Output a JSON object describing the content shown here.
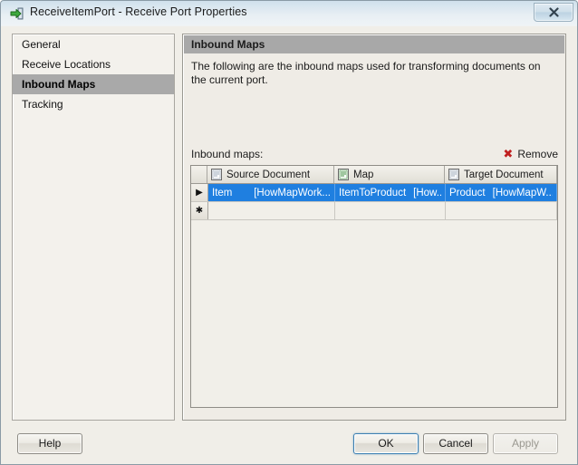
{
  "window": {
    "title": "ReceiveItemPort - Receive Port Properties",
    "icon": "receive-port-icon",
    "close_label": "✕"
  },
  "sidebar": {
    "items": [
      {
        "label": "General",
        "selected": false
      },
      {
        "label": "Receive Locations",
        "selected": false
      },
      {
        "label": "Inbound Maps",
        "selected": true
      },
      {
        "label": "Tracking",
        "selected": false
      }
    ]
  },
  "content": {
    "section_title": "Inbound Maps",
    "description": "The following are the inbound maps used for transforming documents on the current port.",
    "maps_label": "Inbound maps:",
    "remove": {
      "label": "Remove",
      "icon": "red-x-icon",
      "glyph": "✖"
    }
  },
  "grid": {
    "columns": [
      {
        "label": "Source Document",
        "icon": "xml-document-icon"
      },
      {
        "label": "Map",
        "icon": "map-document-icon"
      },
      {
        "label": "Target Document",
        "icon": "xml-document-icon"
      }
    ],
    "rows": [
      {
        "indicator": "▶",
        "selected": true,
        "source_name": "Item",
        "source_qualifier": "[HowMapWork...",
        "map_name": "ItemToProduct",
        "map_qualifier": "[How...",
        "target_name": "Product",
        "target_qualifier": "[HowMapW..."
      },
      {
        "indicator": "✱",
        "selected": false,
        "source_name": "",
        "source_qualifier": "",
        "map_name": "",
        "map_qualifier": "",
        "target_name": "",
        "target_qualifier": ""
      }
    ]
  },
  "footer": {
    "help": "Help",
    "ok": "OK",
    "cancel": "Cancel",
    "apply": "Apply"
  },
  "colors": {
    "selection_blue": "#1f7fe0",
    "nav_selected_gray": "#a9a9a9",
    "header_gray": "#a8a8a8",
    "remove_red": "#c02020",
    "default_button_border": "#3c7fb1"
  }
}
